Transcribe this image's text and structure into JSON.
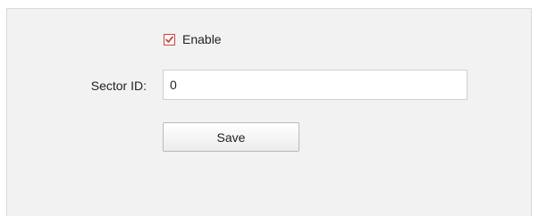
{
  "form": {
    "enable": {
      "label": "Enable",
      "checked": true
    },
    "sector_id": {
      "label": "Sector ID:",
      "value": "0"
    },
    "save_label": "Save"
  },
  "colors": {
    "checkbox_accent": "#c9463d",
    "panel_background": "#f2f2f2"
  }
}
